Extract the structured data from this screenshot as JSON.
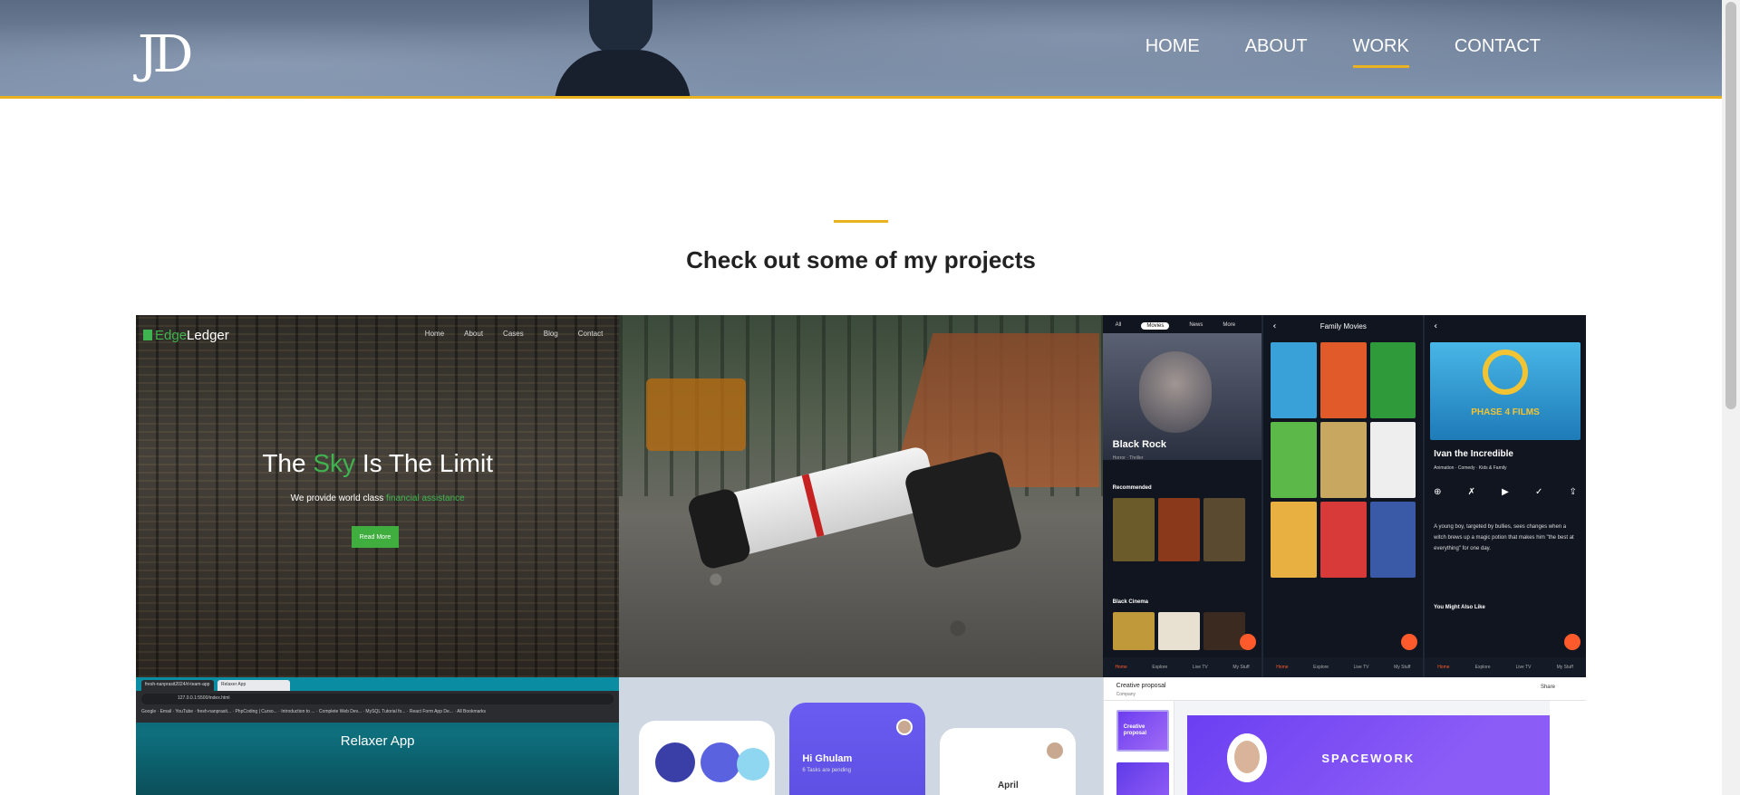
{
  "header": {
    "logo": "JD",
    "nav": [
      "HOME",
      "ABOUT",
      "WORK",
      "CONTACT"
    ],
    "active_nav": "WORK"
  },
  "section": {
    "title": "Check out some of my projects"
  },
  "projects": {
    "edgeledger": {
      "brand_prefix": "Edge",
      "brand_suffix": "Ledger",
      "menu": [
        "Home",
        "About",
        "Cases",
        "Blog",
        "Contact"
      ],
      "hero_the": "The",
      "hero_sky": "Sky",
      "hero_rest": "Is The Limit",
      "sub_prefix": "We provide world class",
      "sub_highlight": "financial assistance",
      "button": "Read More"
    },
    "movies": {
      "tabs": [
        "All",
        "Movies",
        "News",
        "More"
      ],
      "feature_title": "Black Rock",
      "feature_genres": "Horror · Thriller",
      "recommended": "Recommended",
      "black_cinema": "Black Cinema",
      "family_movies": "Family Movies",
      "detail_title": "Ivan the Incredible",
      "detail_meta": "Animation · Comedy · Kids & Family",
      "hero_text": "PHASE 4 FILMS",
      "detail_desc": "A young boy, targeted by bullies, sees changes when a witch brews up a magic potion that makes him \"the best at everything\" for one day.",
      "also_like": "You Might Also Like",
      "bottom_nav": [
        "Home",
        "Explore",
        "Live TV",
        "My Stuff"
      ]
    },
    "relaxer": {
      "tabs": [
        "fresh-nanprasit2024/rl-team-app",
        "Relaxer App"
      ],
      "url": "127.0.0.1:5500/index.html",
      "bookmarks": "Google · Email · YouTube · fresh-nanprasit... · PhpCoding | Curso... · Introduction to ... · Complete Web Dev... · MySQL Tutorial fo... · React Form App De... · All Bookmarks",
      "title": "Relaxer App"
    },
    "tasks": {
      "greeting": "Hi Ghulam",
      "pending": "6 Tasks are pending",
      "month": "April"
    },
    "spacework": {
      "title": "Creative proposal",
      "company": "Company",
      "share": "Share",
      "slide1_label": "Creative proposal",
      "brand": "SPACEWORK"
    }
  }
}
